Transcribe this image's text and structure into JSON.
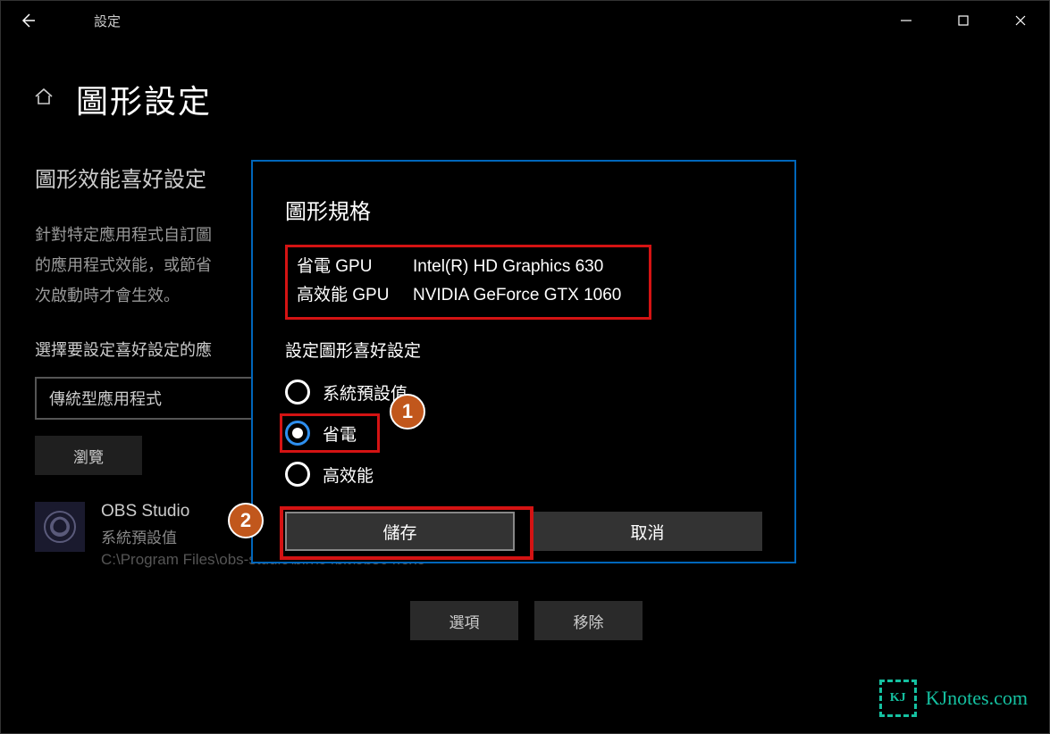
{
  "titlebar": {
    "title": "設定"
  },
  "page": {
    "title": "圖形設定"
  },
  "background": {
    "subtitle": "圖形效能喜好設定",
    "desc_line1": "針對特定應用程式自訂圖",
    "desc_line2": "的應用程式效能，或節省",
    "desc_line3": "次啟動時才會生效。",
    "select_label": "選擇要設定喜好設定的應",
    "dropdown_value": "傳統型應用程式",
    "browse_label": "瀏覽",
    "app": {
      "name": "OBS Studio",
      "status": "系統預設值",
      "path": "C:\\Program Files\\obs-studio\\bin\\64bit\\obs64.exe"
    },
    "options_label": "選項",
    "remove_label": "移除"
  },
  "dialog": {
    "title": "圖形規格",
    "gpu_power_label": "省電 GPU",
    "gpu_power_value": "Intel(R) HD Graphics 630",
    "gpu_perf_label": "高效能 GPU",
    "gpu_perf_value": "NVIDIA GeForce GTX 1060",
    "pref_label": "設定圖形喜好設定",
    "radio_default": "系統預設值",
    "radio_power": "省電",
    "radio_perf": "高效能",
    "save_label": "儲存",
    "cancel_label": "取消"
  },
  "annotations": {
    "badge1": "1",
    "badge2": "2"
  },
  "watermark": {
    "icon_text": "KJ",
    "text": "KJnotes.com"
  }
}
